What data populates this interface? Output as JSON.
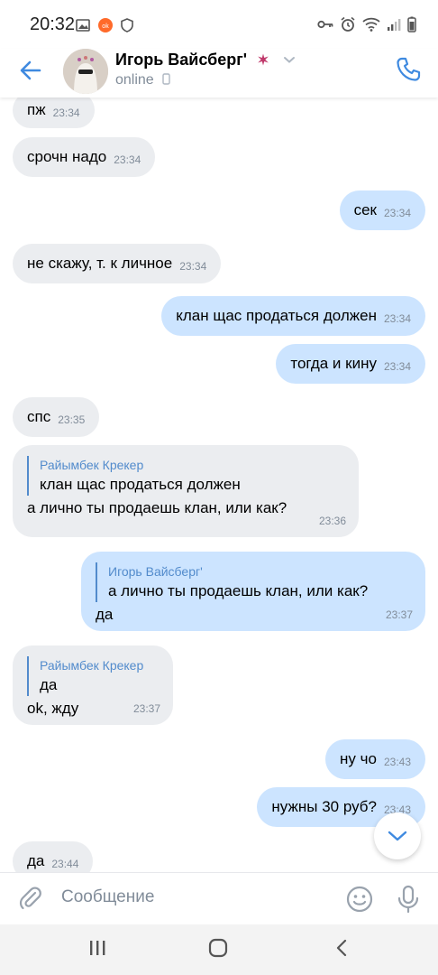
{
  "status_bar": {
    "time": "20:32"
  },
  "header": {
    "name": "Игорь Вайсберг'",
    "status": "online"
  },
  "messages": [
    {
      "dir": "in",
      "text": "пж",
      "time": "23:34"
    },
    {
      "dir": "in",
      "text": "срочн надо",
      "time": "23:34"
    },
    {
      "dir": "out",
      "text": "сек",
      "time": "23:34"
    },
    {
      "dir": "in",
      "text": "не скажу, т. к личное",
      "time": "23:34"
    },
    {
      "dir": "out",
      "text": "клан щас продаться должен",
      "time": "23:34"
    },
    {
      "dir": "out",
      "text": "тогда и кину",
      "time": "23:34"
    },
    {
      "dir": "in",
      "text": "спс",
      "time": "23:35"
    },
    {
      "dir": "in",
      "reply_author": "Райымбек Крекер",
      "reply_text": "клан щас продаться должен",
      "text": "а лично ты продаешь клан, или как?",
      "time": "23:36"
    },
    {
      "dir": "out",
      "reply_author": "Игорь Вайсберг'",
      "reply_text": "а лично ты продаешь клан, или как?",
      "text": "да",
      "time": "23:37"
    },
    {
      "dir": "in",
      "reply_author": "Райымбек Крекер",
      "reply_text": "да",
      "text": "ok, жду",
      "time": "23:37"
    },
    {
      "dir": "out",
      "text": "ну чо",
      "time": "23:43"
    },
    {
      "dir": "out",
      "text": "нужны 30 руб?",
      "time": "23:43"
    },
    {
      "dir": "in",
      "text": "да",
      "time": "23:44"
    }
  ],
  "composer": {
    "placeholder": "Сообщение"
  },
  "colors": {
    "accent": "#2a5885",
    "blue_icon": "#3f8ae0",
    "incoming_bg": "#ebedf0",
    "outgoing_bg": "#cce4ff",
    "reply_line": "#528bcc"
  }
}
